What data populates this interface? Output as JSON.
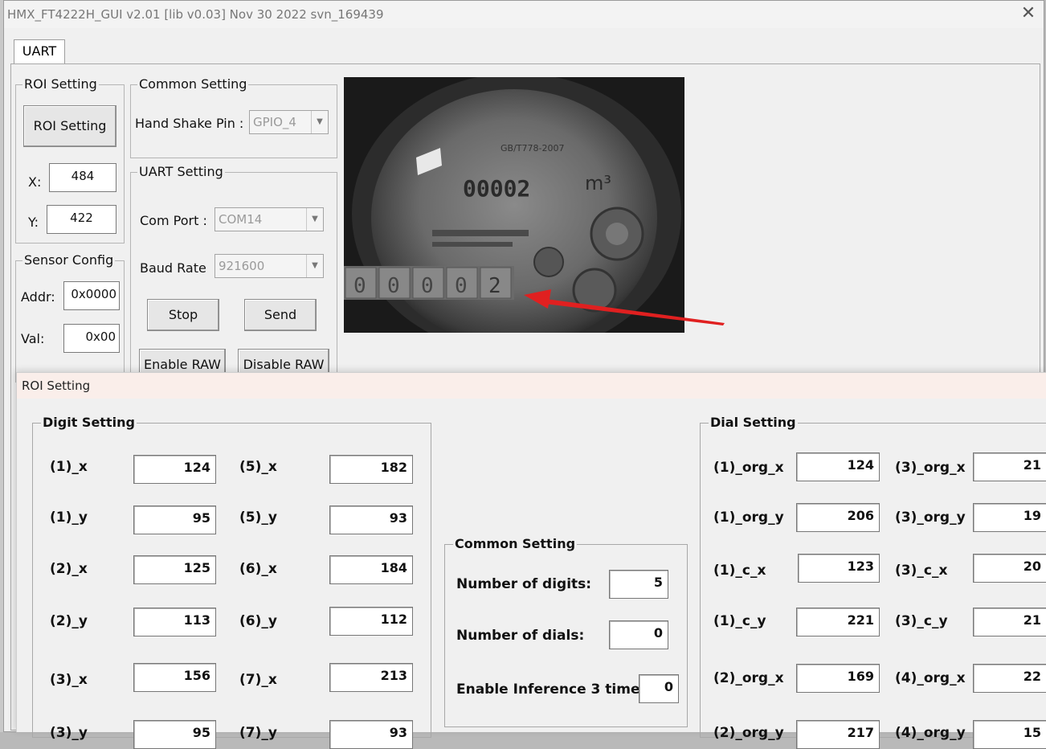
{
  "window": {
    "title": "HMX_FT4222H_GUI v2.01 [lib v0.03] Nov 30 2022 svn_169439",
    "close_glyph": "✕"
  },
  "tabs": [
    {
      "label": "UART"
    }
  ],
  "roi_group": {
    "legend": "ROI Setting",
    "button": "ROI Setting",
    "x_label": "X:",
    "x_value": "484",
    "y_label": "Y:",
    "y_value": "422"
  },
  "common_group": {
    "legend": "Common Setting",
    "handshake_label": "Hand Shake Pin :",
    "handshake_value": "GPIO_4"
  },
  "uart_group": {
    "legend": "UART Setting",
    "com_label": "Com Port :",
    "com_value": "COM14",
    "baud_label": "Baud Rate",
    "baud_value": "921600",
    "stop_button": "Stop",
    "send_button": "Send",
    "enable_raw_button": "Enable RAW",
    "disable_raw_button": "Disable RAW"
  },
  "sensor_group": {
    "legend": "Sensor Config",
    "addr_label": "Addr:",
    "addr_value": "0x0000",
    "val_label": "Val:",
    "val_value": "0x00"
  },
  "camera": {
    "unit": "m³",
    "top_text": "GB/T778-2007",
    "digits": [
      "0",
      "0",
      "0",
      "0",
      "2"
    ]
  },
  "dialog": {
    "title": "ROI Setting",
    "digit_group": {
      "legend": "Digit Setting",
      "fields": [
        {
          "label": "(1)_x",
          "value": "124"
        },
        {
          "label": "(5)_x",
          "value": "182"
        },
        {
          "label": "(1)_y",
          "value": "95"
        },
        {
          "label": "(5)_y",
          "value": "93"
        },
        {
          "label": "(2)_x",
          "value": "125"
        },
        {
          "label": "(6)_x",
          "value": "184"
        },
        {
          "label": "(2)_y",
          "value": "113"
        },
        {
          "label": "(6)_y",
          "value": "112"
        },
        {
          "label": "(3)_x",
          "value": "156"
        },
        {
          "label": "(7)_x",
          "value": "213"
        },
        {
          "label": "(3)_y",
          "value": "95"
        },
        {
          "label": "(7)_y",
          "value": "93"
        }
      ]
    },
    "common_group": {
      "legend": "Common Setting",
      "num_digits_label": "Number of digits:",
      "num_digits_value": "5",
      "num_dials_label": "Number of dials:",
      "num_dials_value": "0",
      "inference_label": "Enable Inference 3 times:",
      "inference_value": "0"
    },
    "dial_group": {
      "legend": "Dial Setting",
      "fields": [
        {
          "label": "(1)_org_x",
          "value": "124"
        },
        {
          "label": "(3)_org_x",
          "value": "21"
        },
        {
          "label": "(1)_org_y",
          "value": "206"
        },
        {
          "label": "(3)_org_y",
          "value": "19"
        },
        {
          "label": "(1)_c_x",
          "value": "123"
        },
        {
          "label": "(3)_c_x",
          "value": "20"
        },
        {
          "label": "(1)_c_y",
          "value": "221"
        },
        {
          "label": "(3)_c_y",
          "value": "21"
        },
        {
          "label": "(2)_org_x",
          "value": "169"
        },
        {
          "label": "(4)_org_x",
          "value": "22"
        },
        {
          "label": "(2)_org_y",
          "value": "217"
        },
        {
          "label": "(4)_org_y",
          "value": "15"
        }
      ]
    }
  }
}
